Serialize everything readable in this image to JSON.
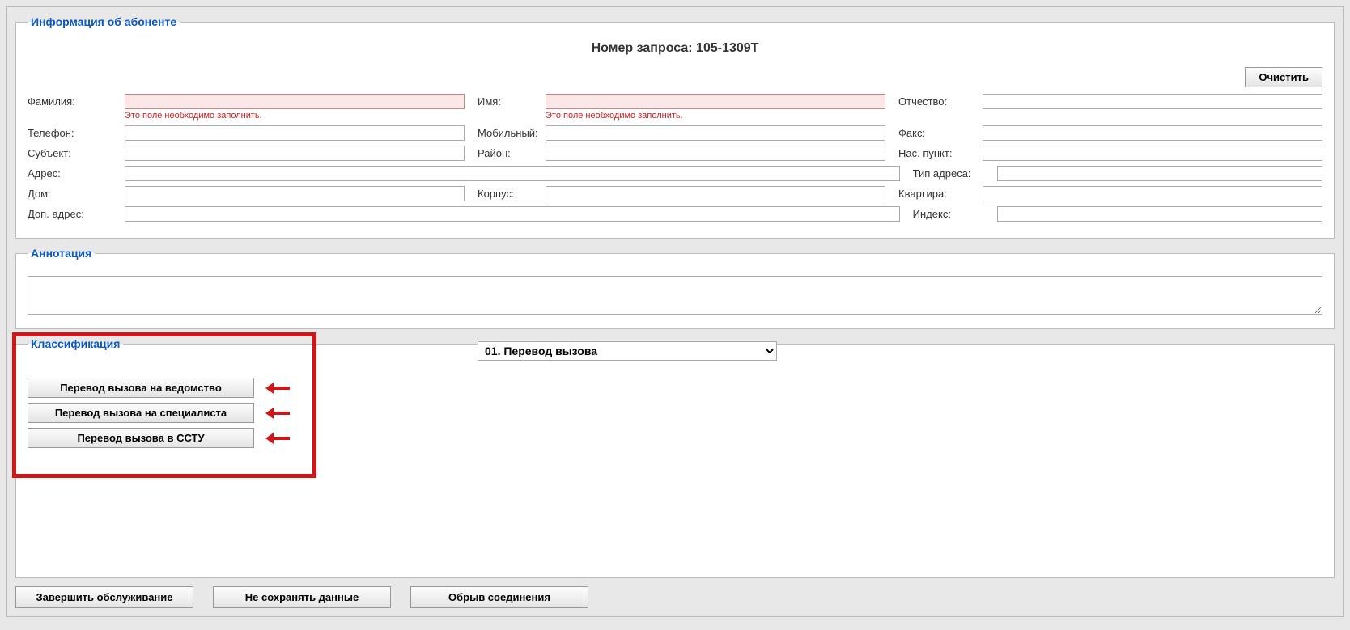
{
  "sections": {
    "subscriber": {
      "legend": "Информация об абоненте"
    },
    "annotation": {
      "legend": "Аннотация"
    },
    "classification": {
      "legend": "Классификация"
    }
  },
  "request_number_label": "Номер запроса: 105-1309Т",
  "clear_button": "Очистить",
  "validation_required": "Это поле необходимо заполнить.",
  "labels": {
    "surname": "Фамилия:",
    "name": "Имя:",
    "patronymic": "Отчество:",
    "phone": "Телефон:",
    "mobile": "Мобильный:",
    "fax": "Факс:",
    "subject": "Субъект:",
    "district": "Район:",
    "locality": "Нас. пункт:",
    "address": "Адрес:",
    "addr_type": "Тип адреса:",
    "house": "Дом:",
    "building": "Корпус:",
    "flat": "Квартира:",
    "add_address": "Доп. адрес:",
    "postcode": "Индекс:"
  },
  "values": {
    "surname": "",
    "name": "",
    "patronymic": "",
    "phone": "",
    "mobile": "",
    "fax": "",
    "subject": "",
    "district": "",
    "locality": "",
    "address": "",
    "addr_type": "",
    "house": "",
    "building": "",
    "flat": "",
    "add_address": "",
    "postcode": "",
    "annotation": ""
  },
  "classification_select": {
    "selected": "01. Перевод вызова",
    "options": [
      "01. Перевод вызова"
    ]
  },
  "classification_buttons": {
    "dept": "Перевод вызова на ведомство",
    "spec": "Перевод вызова на специалиста",
    "sstu": "Перевод вызова в ССТУ"
  },
  "bottom": {
    "finish": "Завершить обслуживание",
    "nosave": "Не сохранять данные",
    "disconnect": "Обрыв соединения"
  }
}
